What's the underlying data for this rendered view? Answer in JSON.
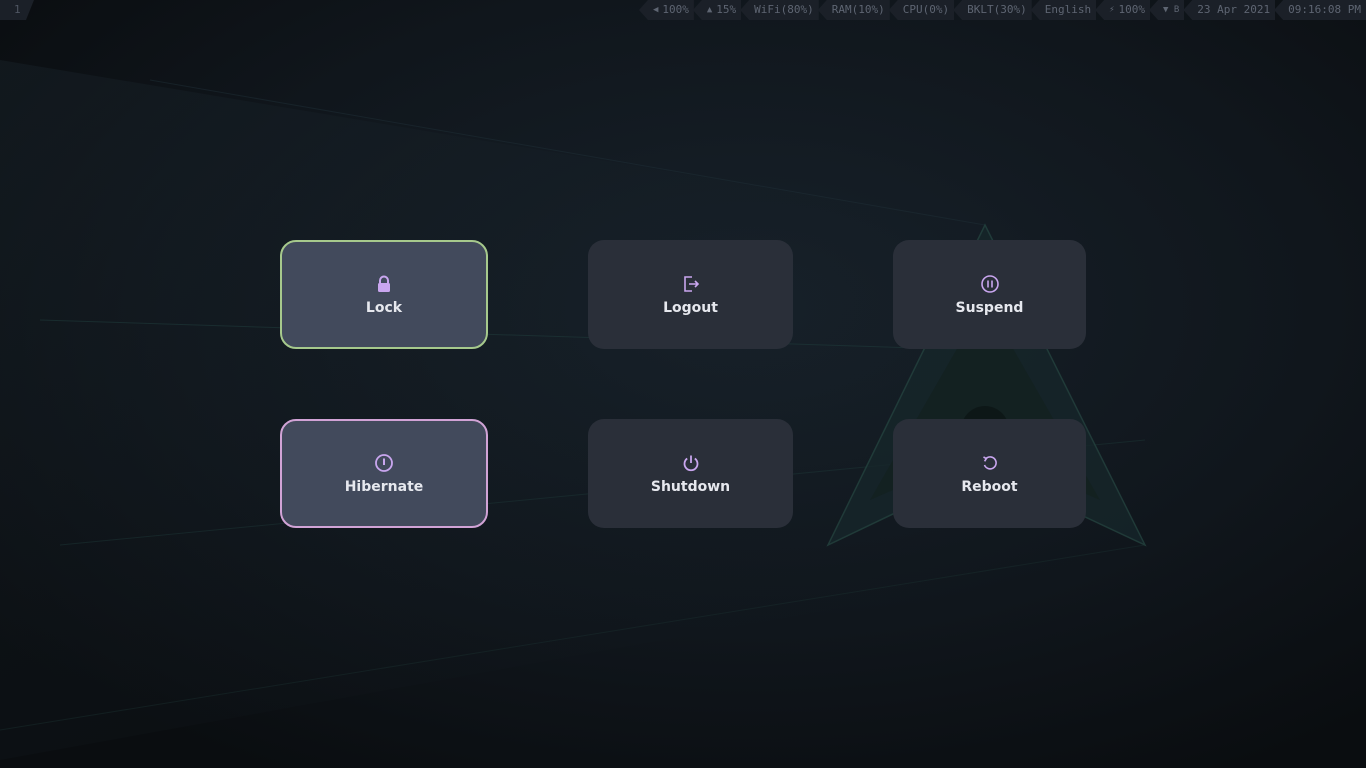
{
  "topbar": {
    "workspace": "1",
    "modules": [
      {
        "icon": "volume-icon",
        "glyph": "◀",
        "text": "100%"
      },
      {
        "icon": "flame-icon",
        "glyph": "▲",
        "text": "15%"
      },
      {
        "icon": "",
        "glyph": "",
        "text": "WiFi(80%)"
      },
      {
        "icon": "",
        "glyph": "",
        "text": "RAM(10%)"
      },
      {
        "icon": "",
        "glyph": "",
        "text": "CPU(0%)"
      },
      {
        "icon": "",
        "glyph": "",
        "text": "BKLT(30%)"
      },
      {
        "icon": "",
        "glyph": "",
        "text": "English"
      },
      {
        "icon": "battery-bolt-icon",
        "glyph": "⚡",
        "text": "100%"
      },
      {
        "icon": "wifi-bluetooth-icon",
        "glyph": "▼ B",
        "text": ""
      },
      {
        "icon": "",
        "glyph": "",
        "text": "23 Apr 2021"
      },
      {
        "icon": "",
        "glyph": "",
        "text": "09:16:08 PM"
      }
    ]
  },
  "power_menu": {
    "buttons": [
      {
        "id": "lock",
        "label": "Lock",
        "icon": "lock-icon"
      },
      {
        "id": "logout",
        "label": "Logout",
        "icon": "logout-icon"
      },
      {
        "id": "suspend",
        "label": "Suspend",
        "icon": "pause-circle-icon"
      },
      {
        "id": "hibernate",
        "label": "Hibernate",
        "icon": "hibernate-icon"
      },
      {
        "id": "shutdown",
        "label": "Shutdown",
        "icon": "power-icon"
      },
      {
        "id": "reboot",
        "label": "Reboot",
        "icon": "restart-icon"
      }
    ]
  },
  "colors": {
    "icon_accent": "#c9a6ef",
    "lock_border": "#a6c98c",
    "hibernate_border": "#d1a3d6",
    "button_bg": "#2a2f39",
    "button_selected_bg": "#424a5c"
  }
}
